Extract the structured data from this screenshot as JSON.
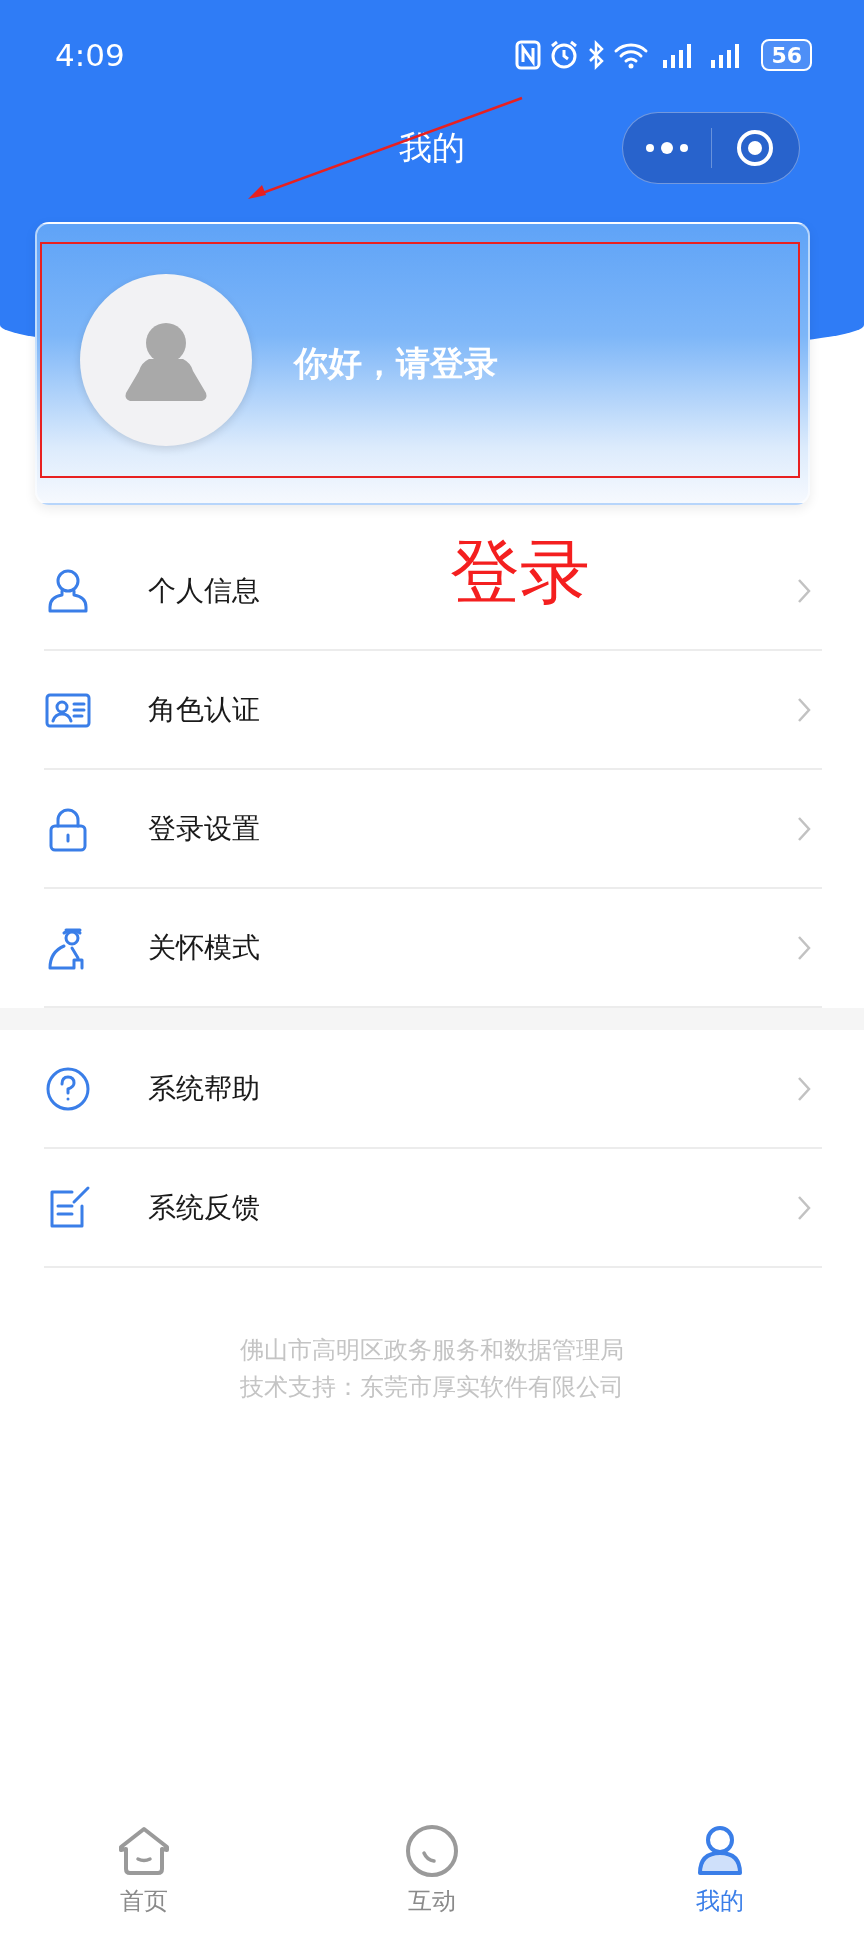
{
  "status_bar": {
    "time": "4:09",
    "battery": "56"
  },
  "header": {
    "title": "我的"
  },
  "profile": {
    "greeting": "你好，请登录"
  },
  "annotation": {
    "label": "登录"
  },
  "menu_groups": [
    {
      "items": [
        {
          "label": "个人信息"
        },
        {
          "label": "角色认证"
        },
        {
          "label": "登录设置"
        },
        {
          "label": "关怀模式"
        }
      ]
    },
    {
      "items": [
        {
          "label": "系统帮助"
        },
        {
          "label": "系统反馈"
        }
      ]
    }
  ],
  "footer": [
    "佛山市高明区政务服务和数据管理局",
    "技术支持：东莞市厚实软件有限公司"
  ],
  "tab_bar": [
    {
      "label": "首页",
      "selected": false
    },
    {
      "label": "互动",
      "selected": false
    },
    {
      "label": "我的",
      "selected": true
    }
  ]
}
